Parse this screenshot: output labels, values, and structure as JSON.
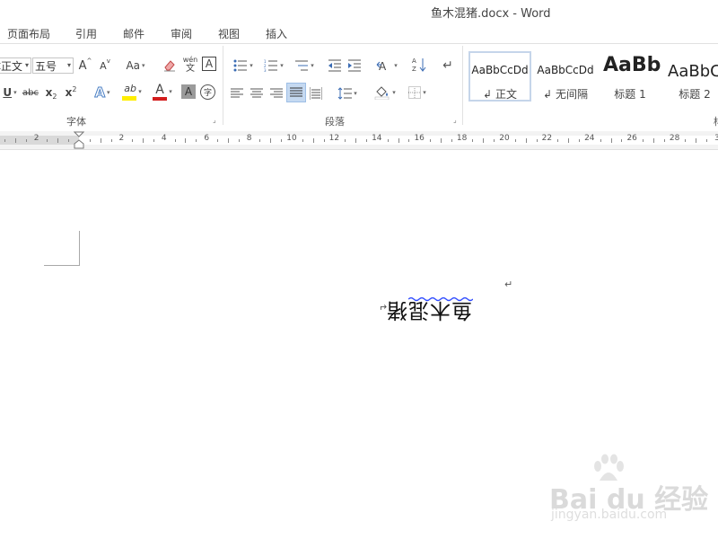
{
  "window": {
    "title": "鱼木混猪.docx - Word"
  },
  "tabs": [
    "页面布局",
    "引用",
    "邮件",
    "审阅",
    "视图",
    "插入"
  ],
  "font": {
    "font_name": "宋体正文",
    "font_size": "五号",
    "group_label": "字体",
    "buttons": {
      "grow": "A",
      "shrink": "A",
      "change_case": "Aa",
      "phonetic_top": "wén",
      "phonetic_bottom": "文",
      "char_border": "A",
      "strike": "abc",
      "subscript": "x",
      "subscript_mark": "2",
      "superscript": "x",
      "superscript_mark": "2",
      "font_color": "A",
      "char_shading": "A",
      "enclose": "字"
    },
    "colors": {
      "highlight": "#ffee00",
      "font_color": "#d31d1d"
    }
  },
  "paragraph": {
    "group_label": "段落"
  },
  "styles": {
    "items": [
      {
        "preview": "AaBbCcDd",
        "name": "正文",
        "mark": "↲"
      },
      {
        "preview": "AaBbCcDd",
        "name": "无间隔",
        "mark": "↲"
      },
      {
        "preview": "AaBb",
        "name": "标题 1"
      },
      {
        "preview": "AaBbC",
        "name": "标题 2"
      }
    ]
  },
  "ruler": {
    "labels": [
      "2",
      "2",
      "4",
      "6",
      "8",
      "10",
      "12",
      "14",
      "16",
      "18",
      "20",
      "22",
      "24",
      "26",
      "28",
      "3"
    ]
  },
  "document": {
    "flipped_text": "鱼木混猪",
    "paragraph_mark": "↵",
    "line_break_mark": "↵"
  },
  "watermark": {
    "brand": "Bai du 经验",
    "url": "jingyan.baidu.com"
  }
}
